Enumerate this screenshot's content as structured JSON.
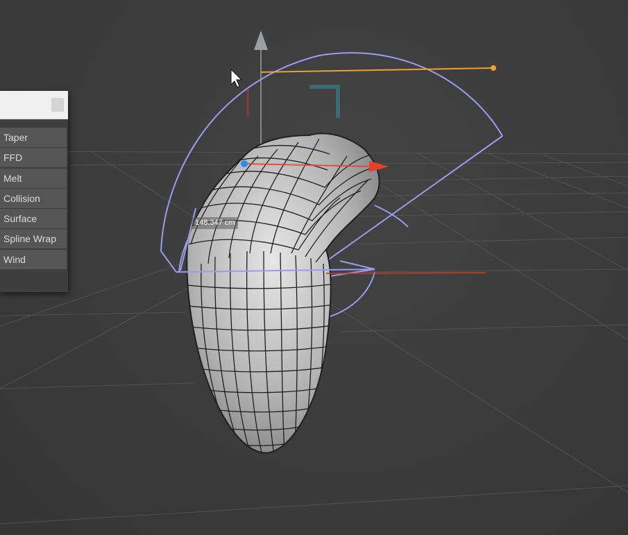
{
  "deformer_menu": {
    "search_placeholder": "",
    "items": [
      {
        "label": "Taper"
      },
      {
        "label": "FFD"
      },
      {
        "label": "Melt"
      },
      {
        "label": "Collision"
      },
      {
        "label": "Surface"
      },
      {
        "label": "Spline Wrap"
      },
      {
        "label": "Wind"
      }
    ]
  },
  "viewport": {
    "dimension_readout": "148.347 cm",
    "colors": {
      "background": "#3a3a3a",
      "grid": "#5a5a5a",
      "deformer_outline": "#9a9cf0",
      "handle": "#f0a030",
      "axis_x": "#e8402a",
      "axis_y": "#9aa0a0",
      "axis_z_point": "#2a8cf0",
      "mesh_fill": "#b8b8b8",
      "wireframe": "#1e1e1e"
    },
    "icons": [
      "y-axis-arrow-icon",
      "x-axis-arrow-icon",
      "mouse-cursor-icon",
      "bend-handle-icon"
    ]
  }
}
